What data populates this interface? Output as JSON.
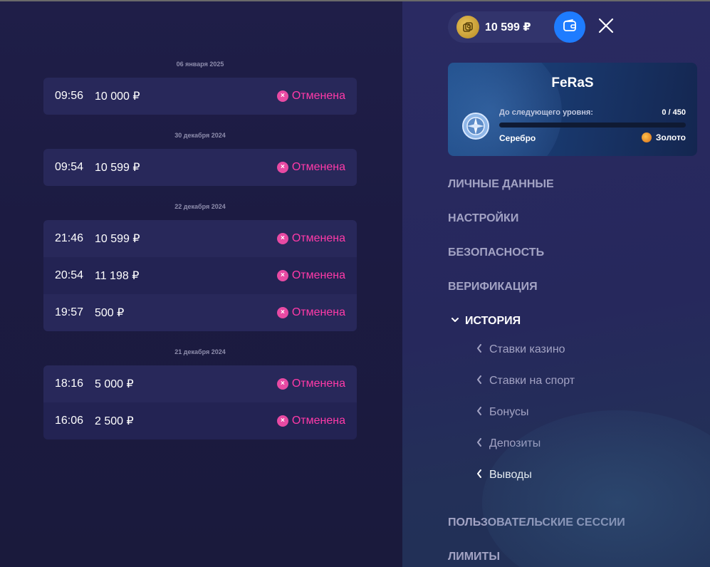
{
  "balance": {
    "amount": "10 599 ₽"
  },
  "history": {
    "groups": [
      {
        "date": "06 января 2025",
        "rows": [
          {
            "time": "09:56",
            "amount": "10 000 ₽",
            "status": "Отменена"
          }
        ]
      },
      {
        "date": "30 декабря 2024",
        "rows": [
          {
            "time": "09:54",
            "amount": "10 599 ₽",
            "status": "Отменена"
          }
        ]
      },
      {
        "date": "22 декабря 2024",
        "rows": [
          {
            "time": "21:46",
            "amount": "10 599 ₽",
            "status": "Отменена"
          },
          {
            "time": "20:54",
            "amount": "11 198 ₽",
            "status": "Отменена"
          },
          {
            "time": "19:57",
            "amount": "500 ₽",
            "status": "Отменена"
          }
        ]
      },
      {
        "date": "21 декабря 2024",
        "rows": [
          {
            "time": "18:16",
            "amount": "5 000 ₽",
            "status": "Отменена"
          },
          {
            "time": "16:06",
            "amount": "2 500 ₽",
            "status": "Отменена"
          }
        ]
      }
    ]
  },
  "profile": {
    "username": "FeRaS",
    "next_level_label": "До следующего уровня:",
    "progress_text": "0 / 450",
    "progress_fraction": 0,
    "current_level": "Серебро",
    "next_level": "Золото"
  },
  "menu": {
    "personal": "ЛИЧНЫЕ ДАННЫЕ",
    "settings": "НАСТРОЙКИ",
    "security": "БЕЗОПАСНОСТЬ",
    "verification": "ВЕРИФИКАЦИЯ",
    "history": "ИСТОРИЯ",
    "history_sub": [
      "Ставки казино",
      "Ставки на спорт",
      "Бонусы",
      "Депозиты",
      "Выводы"
    ],
    "sessions": "ПОЛЬЗОВАТЕЛЬСКИЕ СЕССИИ",
    "limits": "ЛИМИТЫ"
  },
  "colors": {
    "accent_blue": "#1e7cff",
    "status_cancelled": "#ff3aa8",
    "coin_gold": "#d4a93a"
  },
  "icons": {
    "balance": "coin-icon",
    "wallet": "wallet-icon",
    "close": "close-icon",
    "level": "silver-level-icon",
    "next_level": "gold-level-icon"
  }
}
